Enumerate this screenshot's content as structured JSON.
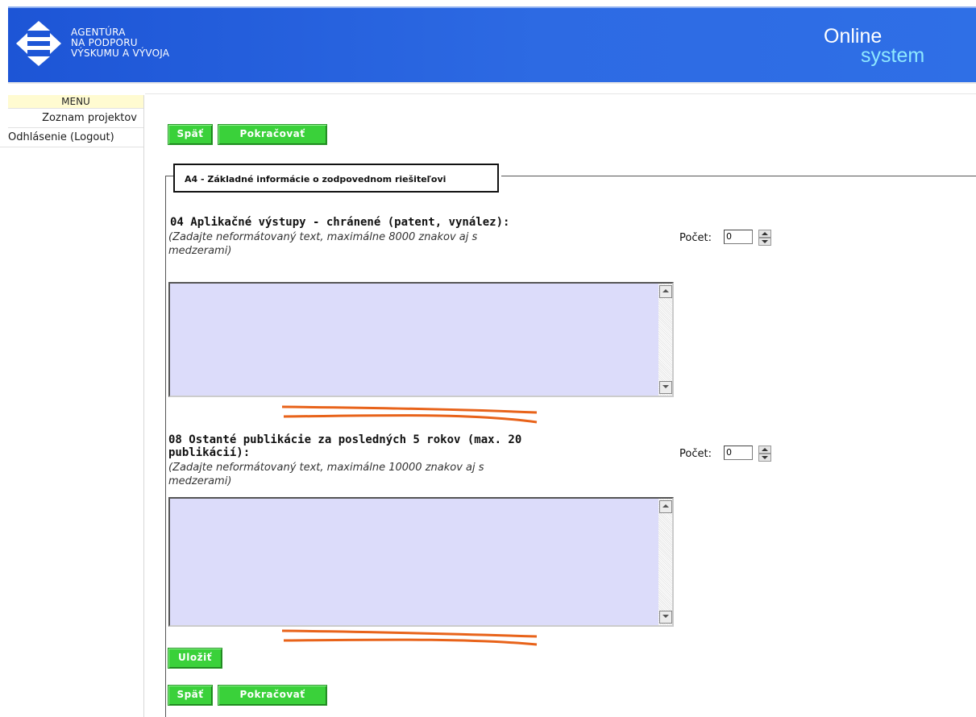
{
  "header": {
    "logo_lines": [
      "AGENTÚRA",
      "NA PODPORU",
      "VÝSKUMU A VÝVOJA"
    ],
    "online": "Online",
    "system": "system"
  },
  "sidebar": {
    "title": "MENU",
    "items": [
      {
        "label": "Zoznam projektov"
      },
      {
        "label": "Odhlásenie (Logout)"
      }
    ]
  },
  "nav": {
    "back_label": "Späť",
    "continue_label": "Pokračovať",
    "save_label": "Uložiť"
  },
  "section": {
    "legend": "A4 - Základné informácie o zodpovednom riešiteľovi"
  },
  "fields": [
    {
      "title_lines": [
        "04 Aplikačné výstupy - chránené (patent, vynález):"
      ],
      "hint_lines": [
        "(Zadajte neformátovaný text, maximálne 8000 znakov aj s",
        "medzerami)"
      ],
      "count_label": "Počet:",
      "count_value": "0",
      "text": ""
    },
    {
      "title_lines": [
        "08 Ostanté publikácie za posledných 5 rokov (max. 20",
        "publikácií):"
      ],
      "hint_lines": [
        "(Zadajte neformátovaný text, maximálne 10000 znakov aj s",
        "medzerami)"
      ],
      "count_label": "Počet:",
      "count_value": "0",
      "text": ""
    }
  ],
  "colors": {
    "header_blue": "#2a62e0",
    "button_green": "#3ad13a",
    "textarea_bg": "#dcdcfa",
    "strike_orange": "#e8631a",
    "menu_title_bg": "#fffbd1"
  }
}
